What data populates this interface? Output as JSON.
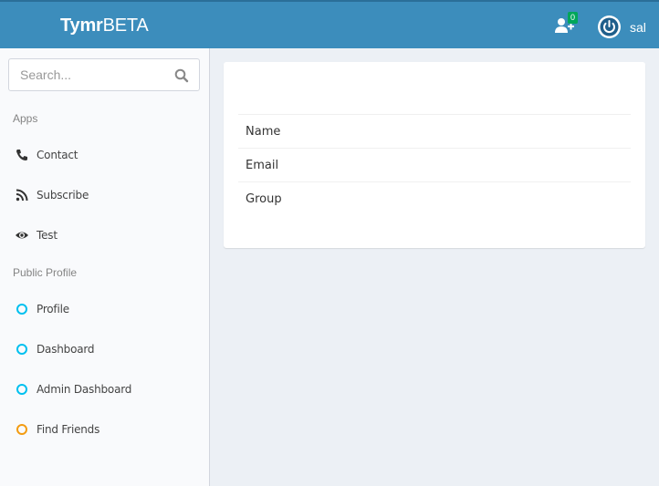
{
  "header": {
    "brand_bold": "Tymr",
    "brand_rest": "BETA",
    "friend_badge": "0",
    "username": "sal",
    "icons": {
      "friend": "user-plus-icon",
      "power": "power-icon"
    },
    "colors": {
      "bar": "#3c8dbc",
      "badge": "#00a65a"
    }
  },
  "sidebar": {
    "search": {
      "placeholder": "Search...",
      "value": ""
    },
    "sections": [
      {
        "title": "Apps",
        "items": [
          {
            "label": "Contact",
            "icon": "phone-icon"
          },
          {
            "label": "Subscribe",
            "icon": "rss-icon"
          },
          {
            "label": "Test",
            "icon": "eye-icon"
          }
        ]
      },
      {
        "title": "Public Profile",
        "items": [
          {
            "label": "Profile",
            "icon": "circle-icon",
            "color": "#00c0ef"
          },
          {
            "label": "Dashboard",
            "icon": "circle-icon",
            "color": "#00c0ef"
          },
          {
            "label": "Admin Dashboard",
            "icon": "circle-icon",
            "color": "#00c0ef"
          },
          {
            "label": "Find Friends",
            "icon": "circle-icon",
            "color": "#f39c12"
          }
        ]
      }
    ]
  },
  "main": {
    "fields": [
      "Name",
      "Email",
      "Group"
    ]
  }
}
